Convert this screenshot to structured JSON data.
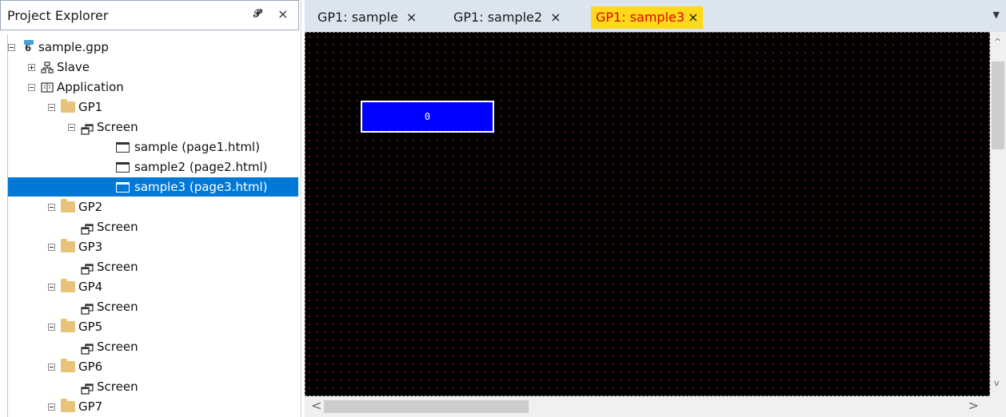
{
  "explorer": {
    "title": "Project Explorer",
    "pin_icon": "pin-icon",
    "close_label": "×"
  },
  "tree": {
    "project": "sample.gpp",
    "slave": "Slave",
    "application": "Application",
    "gp1": "GP1",
    "gp1_screen": "Screen",
    "page1": "sample (page1.html)",
    "page2": "sample2 (page2.html)",
    "page3": "sample3 (page3.html)",
    "gp2": "GP2",
    "gp2_screen": "Screen",
    "gp3": "GP3",
    "gp3_screen": "Screen",
    "gp4": "GP4",
    "gp4_screen": "Screen",
    "gp5": "GP5",
    "gp5_screen": "Screen",
    "gp6": "GP6",
    "gp6_screen": "Screen",
    "gp7": "GP7"
  },
  "tabs": [
    {
      "label": "GP1: sample",
      "close": "×",
      "active": false
    },
    {
      "label": "GP1: sample2",
      "close": "×",
      "active": false
    },
    {
      "label": "GP1: sample3",
      "close": "×",
      "active": true
    }
  ],
  "tab_overflow": "▼",
  "canvas": {
    "numeric_display_value": "0",
    "background": "#000000",
    "grid_dot_color": "#7a1a1a",
    "display_fill": "#0000ff"
  },
  "colors": {
    "active_tab_bg": "#ffd91a",
    "active_tab_text": "#e00000",
    "selection": "#0078d7"
  },
  "scroll": {
    "up": "^",
    "down": "v",
    "left": "<",
    "right": ">"
  }
}
